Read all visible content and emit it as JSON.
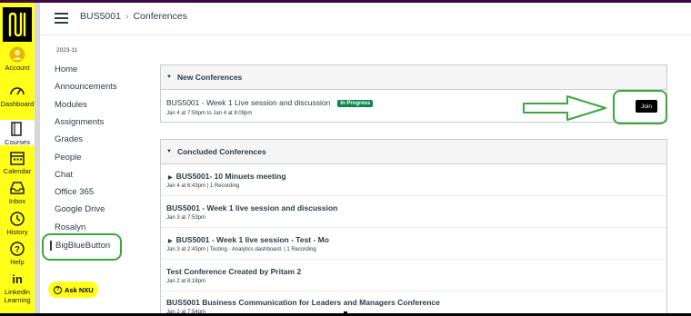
{
  "colors": {
    "brand_yellow": "#ffff1a",
    "active_badge": "#0b874b",
    "highlight_green": "#39a83c",
    "text": "#2d3b45"
  },
  "global_nav": {
    "items": [
      {
        "label": "Account",
        "icon": "account-icon"
      },
      {
        "label": "Dashboard",
        "icon": "dashboard-icon"
      },
      {
        "label": "Courses",
        "icon": "courses-icon"
      },
      {
        "label": "Calendar",
        "icon": "calendar-icon"
      },
      {
        "label": "Inbox",
        "icon": "inbox-icon"
      },
      {
        "label": "History",
        "icon": "history-icon"
      },
      {
        "label": "Help",
        "icon": "help-icon"
      },
      {
        "label": "Linkedin Learning",
        "icon": "linkedin-icon"
      }
    ]
  },
  "header": {
    "course": "BUS5001",
    "page": "Conferences"
  },
  "course_nav": {
    "term": "2023-11",
    "items": [
      "Home",
      "Announcements",
      "Modules",
      "Assignments",
      "Grades",
      "People",
      "Chat",
      "Office 365",
      "Google Drive",
      "Rosalyn",
      "BigBlueButton"
    ]
  },
  "ask": "Ask NXU",
  "new_conferences": {
    "heading": "New Conferences",
    "items": [
      {
        "title": "BUS5001 - Week 1 Live session and discussion",
        "badge": "In Progress",
        "time": "Jan 4 at 7:59pm to Jan 4 at 8:09pm",
        "join": "Join"
      }
    ]
  },
  "concluded_conferences": {
    "heading": "Concluded Conferences",
    "items": [
      {
        "title": "BUS5001- 10 Minuets meeting",
        "meta": "Jan 4 at 6:43pm   |  1 Recording"
      },
      {
        "title": "BUS5001 - Week 1 live session and discussion",
        "meta": "Jan 3 at 7:53pm"
      },
      {
        "title": "BUS5001 - Week 1 live session - Test - Mo",
        "meta": "Jan 3 at 2:43pm   |  Testing - Analytics dashboard.   |  1 Recording"
      },
      {
        "title": "Test Conference Created by Pritam 2",
        "meta": "Jan 2 at 8:18pm"
      },
      {
        "title": "BUS5001 Business Communication for Leaders and Managers Conference",
        "meta": "Jan 2 at 7:54pm"
      }
    ]
  }
}
